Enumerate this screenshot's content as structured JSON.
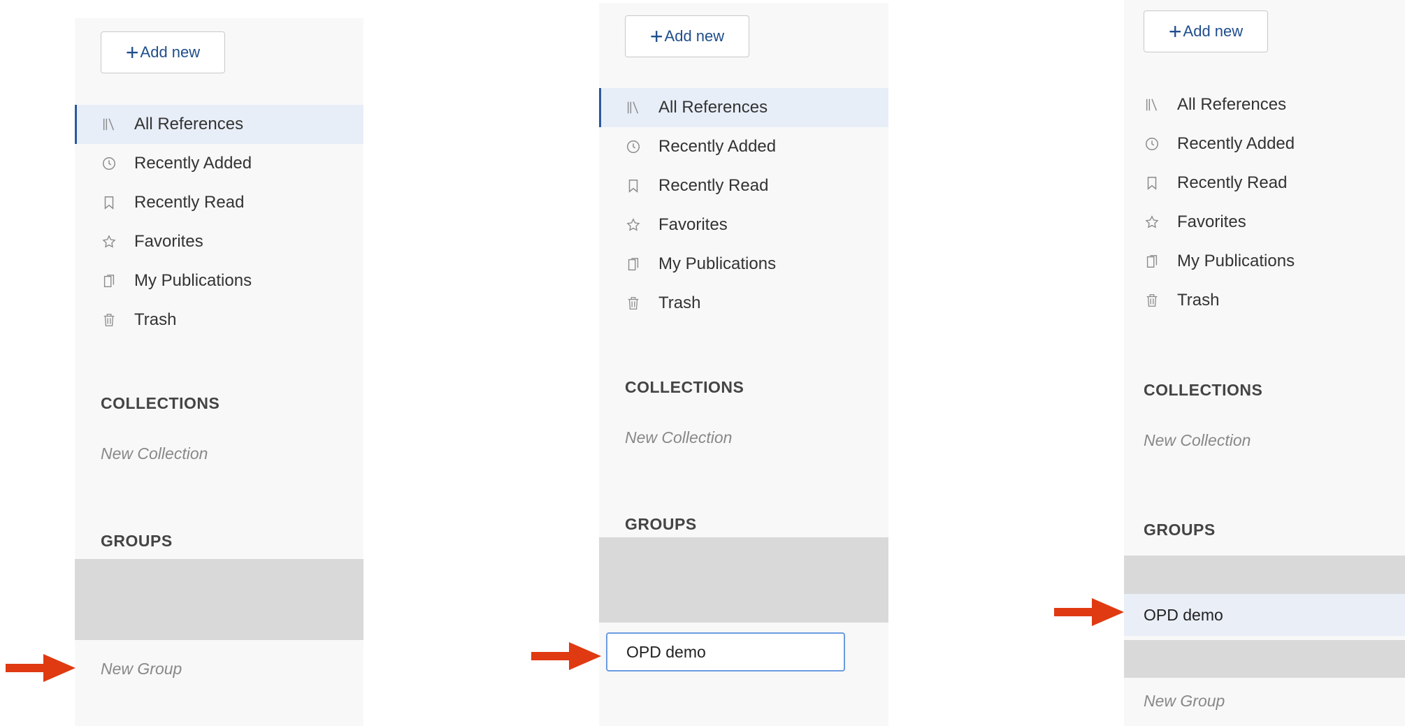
{
  "add_new_label": "Add new",
  "nav_items": [
    {
      "label": "All References",
      "icon": "library-icon"
    },
    {
      "label": "Recently Added",
      "icon": "clock-icon"
    },
    {
      "label": "Recently Read",
      "icon": "bookmark-icon"
    },
    {
      "label": "Favorites",
      "icon": "star-icon"
    },
    {
      "label": "My Publications",
      "icon": "publications-icon"
    },
    {
      "label": "Trash",
      "icon": "trash-icon"
    }
  ],
  "collections_heading": "COLLECTIONS",
  "new_collection_label": "New Collection",
  "groups_heading": "GROUPS",
  "new_group_label": "New Group",
  "group_name_input_value": "OPD demo",
  "created_group_name": "OPD demo",
  "colors": {
    "accent": "#2c58a0",
    "arrow": "#e03a12",
    "active_background": "#e8eef8",
    "input_border": "#6b9be0"
  }
}
